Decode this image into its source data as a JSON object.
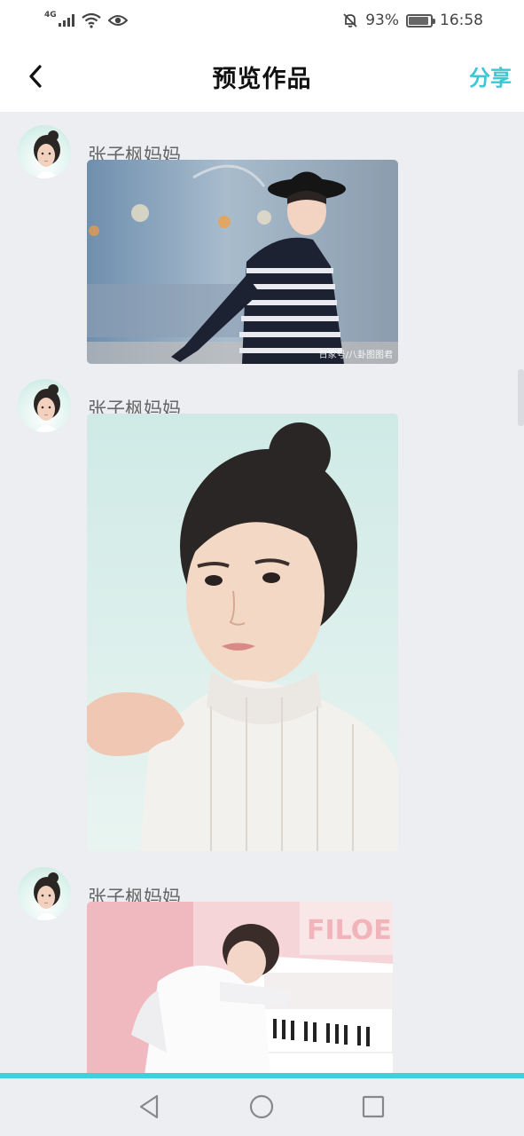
{
  "status_bar": {
    "network": "4G",
    "battery": "93%",
    "time": "16:58"
  },
  "header": {
    "title": "预览作品",
    "share_label": "分享"
  },
  "posts": [
    {
      "author": "张子枫妈妈",
      "watermark": "日家号/八卦图图君"
    },
    {
      "author": "张子枫妈妈"
    },
    {
      "author": "张子枫妈妈",
      "photo_text": "FILOE"
    }
  ],
  "colors": {
    "accent": "#3cc6d6",
    "background": "#eceef2"
  },
  "icons": {
    "back": "chevron-left-icon",
    "wifi": "wifi-icon",
    "eye": "eye-icon",
    "mute": "bell-off-icon",
    "battery": "battery-icon",
    "nav_back": "triangle-back-icon",
    "nav_home": "circle-home-icon",
    "nav_recent": "square-recent-icon"
  }
}
